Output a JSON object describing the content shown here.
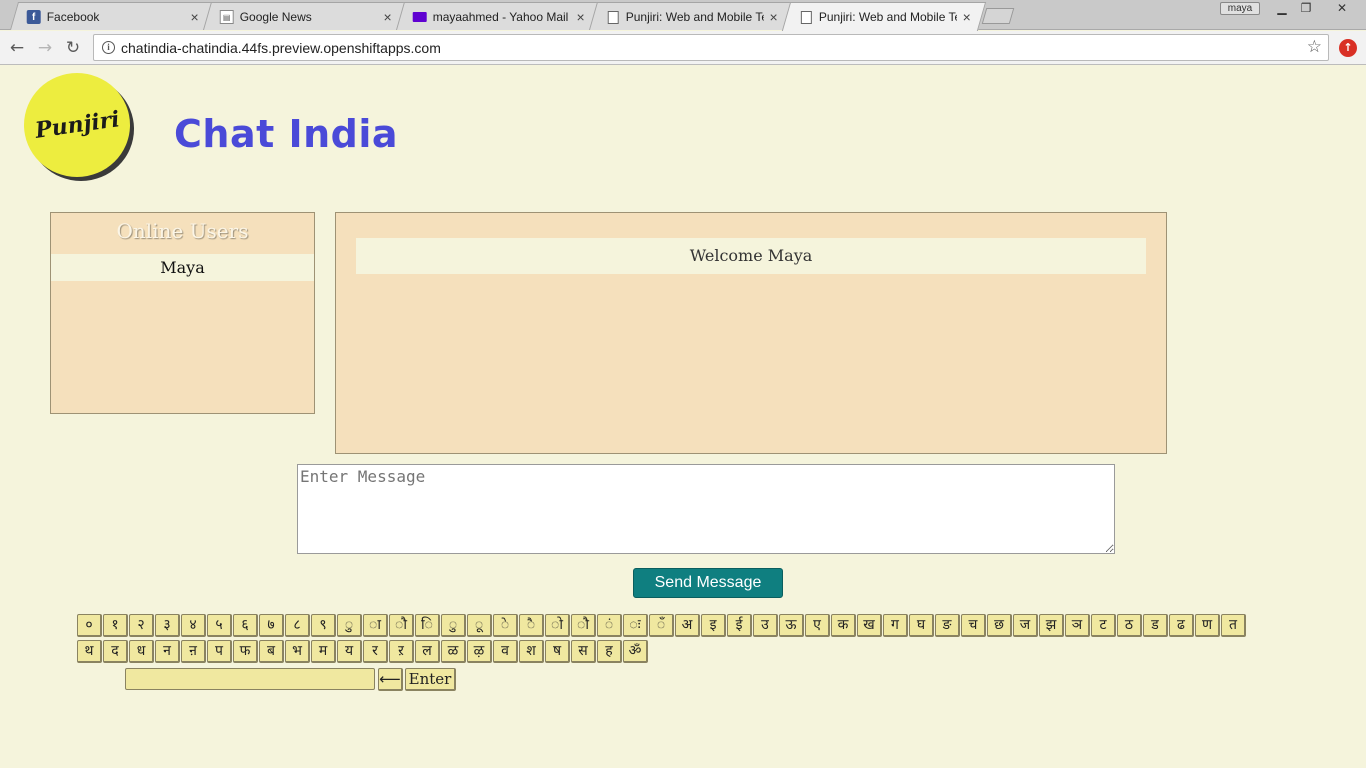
{
  "browser": {
    "tabs": [
      {
        "title": "Facebook",
        "icon": "facebook-icon"
      },
      {
        "title": "Google News",
        "icon": "google-news-icon"
      },
      {
        "title": "mayaahmed - Yahoo Mail",
        "icon": "mail-icon"
      },
      {
        "title": "Punjiri: Web and Mobile Te",
        "icon": "page-icon"
      },
      {
        "title": "Punjiri: Web and Mobile Te",
        "icon": "page-icon",
        "active": true
      }
    ],
    "close_glyph": "×",
    "profile_name": "maya",
    "url": "chatindia-chatindia.44fs.preview.openshiftapps.com"
  },
  "header": {
    "logo_text": "Punjiri",
    "title": "Chat India"
  },
  "users_panel": {
    "title": "Online Users",
    "users": [
      "Maya"
    ]
  },
  "chat": {
    "welcome": "Welcome Maya"
  },
  "composer": {
    "placeholder": "Enter Message",
    "send_label": "Send Message"
  },
  "keyboard": {
    "row1": [
      "०",
      "१",
      "२",
      "३",
      "४",
      "५",
      "६",
      "७",
      "८",
      "९",
      "ु",
      "ा",
      "ौ",
      "ि",
      "ु",
      "ू",
      "े",
      "ै",
      "ो",
      "ौ",
      "ं",
      "ः",
      "ँ",
      "अ",
      "इ",
      "ई",
      "उ",
      "ऊ",
      "ए",
      "क",
      "ख",
      "ग",
      "घ",
      "ङ",
      "च",
      "छ",
      "ज",
      "झ",
      "ञ",
      "ट",
      "ठ",
      "ड",
      "ढ",
      "ण",
      "त"
    ],
    "row2": [
      "थ",
      "द",
      "ध",
      "न",
      "ऩ",
      "प",
      "फ",
      "ब",
      "भ",
      "म",
      "य",
      "र",
      "ऱ",
      "ल",
      "ळ",
      "ऴ",
      "व",
      "श",
      "ष",
      "स",
      "ह",
      "ॐ"
    ],
    "backspace_label": "⟵",
    "enter_label": "Enter"
  },
  "colors": {
    "page_bg": "#f5f4dc",
    "panel_bg": "#f5e0bc",
    "title_color": "#4a4ad8",
    "send_button": "#0f7f80",
    "key_bg": "#f0e8a0",
    "logo_yellow": "#eded3f"
  }
}
